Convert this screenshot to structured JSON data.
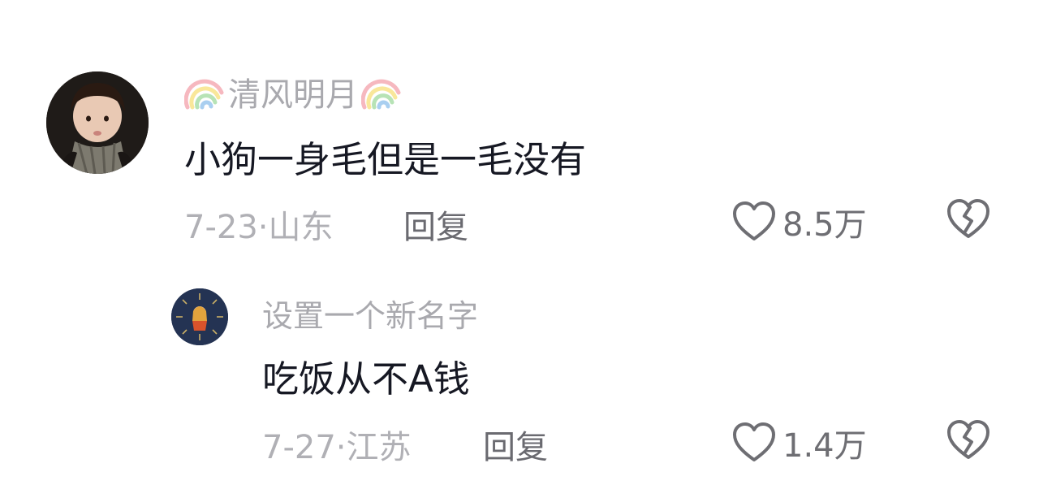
{
  "comments": [
    {
      "username": "清风明月",
      "text": "小狗一身毛但是一毛没有",
      "date_location": "7-23·山东",
      "reply_label": "回复",
      "likes": "8.5万"
    },
    {
      "username": "设置一个新名字",
      "text": "吃饭从不A钱",
      "date_location": "7-27·江苏",
      "reply_label": "回复",
      "likes": "1.4万"
    }
  ],
  "colors": {
    "username": "#a9a9ae",
    "text": "#161823",
    "meta": "#b0b0b5",
    "reply": "#6a6a70",
    "icon": "#6e6e73"
  },
  "icons": {
    "like": "heart-outline-icon",
    "dislike": "broken-heart-icon",
    "name_decoration": "rainbow-icon"
  }
}
